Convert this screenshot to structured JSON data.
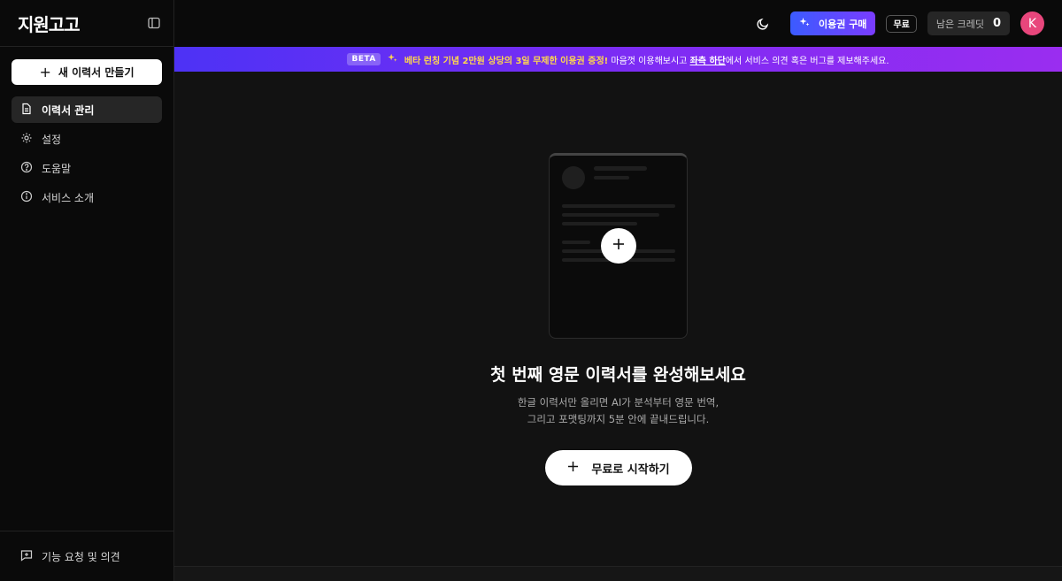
{
  "app": {
    "logo": "지원고고"
  },
  "sidebar": {
    "new_button": "새 이력서 만들기",
    "items": [
      {
        "label": "이력서 관리",
        "icon": "file-icon",
        "active": true
      },
      {
        "label": "설정",
        "icon": "gear-icon"
      },
      {
        "label": "도움말",
        "icon": "help-circle-icon"
      },
      {
        "label": "서비스 소개",
        "icon": "info-icon"
      }
    ],
    "footer": "기능 요청 및 의견"
  },
  "header": {
    "buy_label": "이용권 구매",
    "plan_badge": "무료",
    "credits_label": "남은 크레딧",
    "credits_value": "0",
    "avatar_initial": "K"
  },
  "banner": {
    "beta": "BETA",
    "highlight": "베타 런칭 기념 2만원 상당의 3일 무제한 이용권 증정!",
    "text1": "마음껏 이용해보시고",
    "link": "좌측 하단",
    "text2": "에서 서비스 의견 혹은 버그를 제보해주세요."
  },
  "main": {
    "headline": "첫 번째 영문 이력서를 완성해보세요",
    "sub_line1": "한글 이력서만 올리면 AI가 분석부터 영문 번역,",
    "sub_line2": "그리고 포맷팅까지 5분 안에 끝내드립니다.",
    "start_button": "무료로 시작하기"
  },
  "colors": {
    "accent_start": "#3b5bff",
    "accent_end": "#7a3cff",
    "avatar": "#e8467c",
    "highlight": "#ffd84d"
  }
}
